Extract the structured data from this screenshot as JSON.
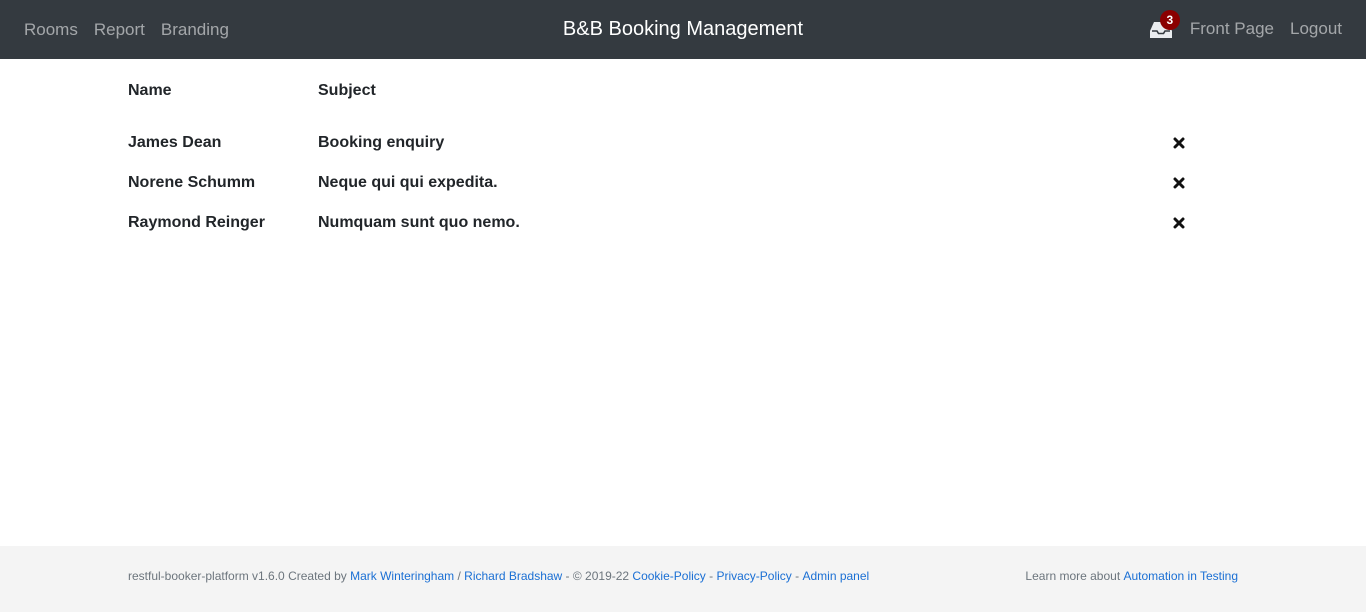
{
  "nav": {
    "links": [
      "Rooms",
      "Report",
      "Branding"
    ],
    "title": "B&B Booking Management",
    "unread_count": "3",
    "front_page": "Front Page",
    "logout": "Logout"
  },
  "table": {
    "headers": {
      "name": "Name",
      "subject": "Subject"
    },
    "rows": [
      {
        "name": "James Dean",
        "subject": "Booking enquiry"
      },
      {
        "name": "Norene Schumm",
        "subject": "Neque qui qui expedita."
      },
      {
        "name": "Raymond Reinger",
        "subject": "Numquam sunt quo nemo."
      }
    ]
  },
  "footer": {
    "prefix": "restful-booker-platform v1.6.0 Created by ",
    "author1": "Mark Winteringham",
    "sep1": " / ",
    "author2": "Richard Bradshaw",
    "copyright": " - © 2019-22 ",
    "cookie": "Cookie-Policy",
    "dash1": " - ",
    "privacy": "Privacy-Policy",
    "dash2": " - ",
    "admin": "Admin panel",
    "learn": "Learn more about ",
    "automation": "Automation in Testing"
  },
  "colors": {
    "navbar": "#343a40",
    "badge": "#8b0000",
    "link": "#1a6fd4",
    "footer_bg": "#f4f4f4"
  },
  "icons": {
    "inbox": "inbox-icon",
    "delete": "close-icon"
  }
}
